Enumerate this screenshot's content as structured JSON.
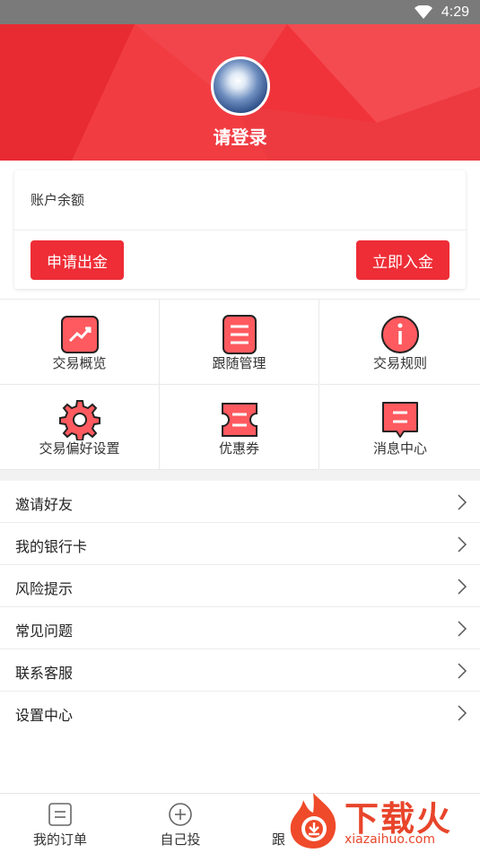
{
  "status_bar": {
    "time": "4:29",
    "icon": "wifi-icon"
  },
  "profile": {
    "login_text": "请登录",
    "avatar_icon": "avatar"
  },
  "balance": {
    "label": "账户余额",
    "withdraw_label": "申请出金",
    "deposit_label": "立即入金"
  },
  "grid": [
    {
      "label": "交易概览",
      "icon": "trend-chart-icon"
    },
    {
      "label": "跟随管理",
      "icon": "list-icon"
    },
    {
      "label": "交易规则",
      "icon": "info-icon"
    },
    {
      "label": "交易偏好设置",
      "icon": "gear-icon"
    },
    {
      "label": "优惠券",
      "icon": "coupon-icon"
    },
    {
      "label": "消息中心",
      "icon": "message-icon"
    }
  ],
  "menu": [
    {
      "label": "邀请好友"
    },
    {
      "label": "我的银行卡"
    },
    {
      "label": "风险提示"
    },
    {
      "label": "常见问题"
    },
    {
      "label": "联系客服"
    },
    {
      "label": "设置中心"
    }
  ],
  "tabbar": [
    {
      "label": "我的订单",
      "icon": "order-icon"
    },
    {
      "label": "自己投",
      "icon": "plus-circle-icon"
    },
    {
      "label": "跟",
      "icon": "follow-icon"
    }
  ],
  "watermark": {
    "text_cn": "下载火",
    "text_en": "xiazaihuo.com"
  },
  "colors": {
    "brand_red": "#ee2d36",
    "hero_red": "#f0333a"
  }
}
